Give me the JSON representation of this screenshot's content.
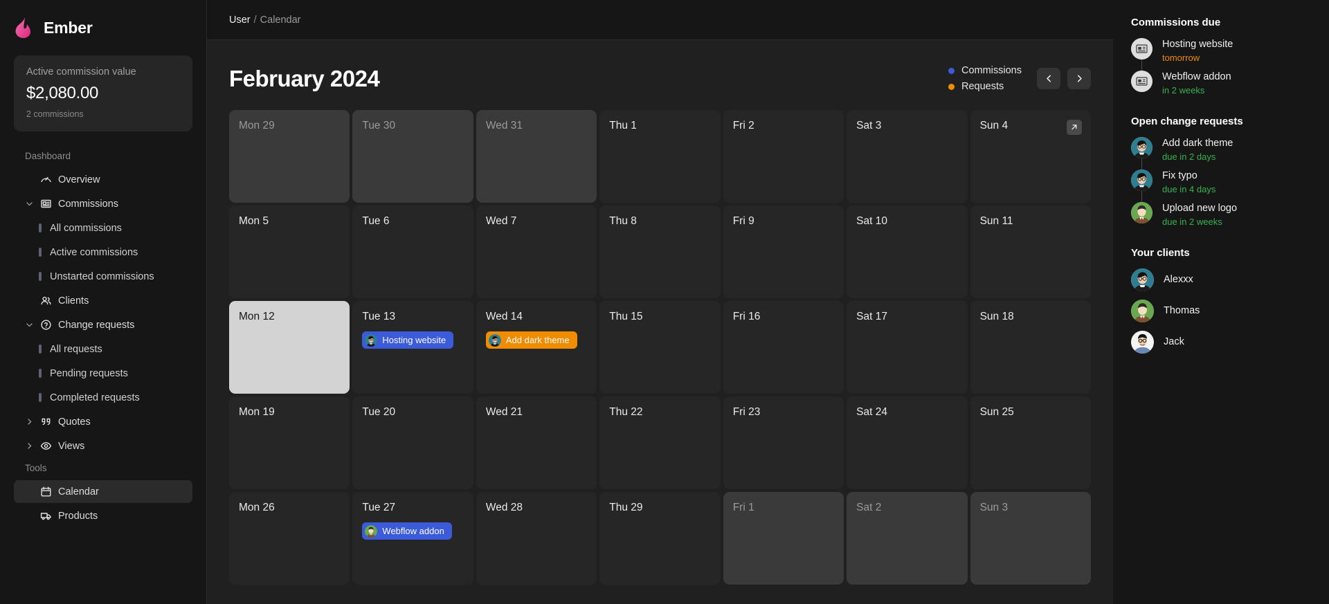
{
  "brand": {
    "name": "Ember",
    "logo_icon": "flame-icon",
    "color": "#ec4899"
  },
  "stat_card": {
    "label": "Active commission value",
    "value": "$2,080.00",
    "sub": "2 commissions"
  },
  "sidebar": {
    "sections": [
      {
        "title": "Dashboard",
        "items": [
          {
            "label": "Overview",
            "icon": "gauge-icon",
            "type": "item",
            "caret": "none",
            "active": false
          },
          {
            "label": "Commissions",
            "icon": "invoice-icon",
            "type": "item",
            "caret": "down",
            "active": false
          },
          {
            "label": "All commissions",
            "type": "child"
          },
          {
            "label": "Active commissions",
            "type": "child"
          },
          {
            "label": "Unstarted commissions",
            "type": "child"
          },
          {
            "label": "Clients",
            "icon": "users-icon",
            "type": "item",
            "caret": "none",
            "active": false
          },
          {
            "label": "Change requests",
            "icon": "help-circle-icon",
            "type": "item",
            "caret": "down",
            "active": false
          },
          {
            "label": "All requests",
            "type": "child"
          },
          {
            "label": "Pending requests",
            "type": "child"
          },
          {
            "label": "Completed requests",
            "type": "child"
          },
          {
            "label": "Quotes",
            "icon": "quote-icon",
            "type": "item",
            "caret": "right",
            "active": false
          },
          {
            "label": "Views",
            "icon": "eye-icon",
            "type": "item",
            "caret": "right",
            "active": false
          }
        ]
      },
      {
        "title": "Tools",
        "items": [
          {
            "label": "Calendar",
            "icon": "calendar-icon",
            "type": "item",
            "caret": "none",
            "active": true
          },
          {
            "label": "Products",
            "icon": "truck-icon",
            "type": "item",
            "caret": "none",
            "active": false
          }
        ]
      }
    ]
  },
  "breadcrumb": {
    "current": "User",
    "separator": "/",
    "next": "Calendar"
  },
  "calendar": {
    "title": "February 2024",
    "legend": [
      {
        "label": "Commissions",
        "color": "#3b5bdb"
      },
      {
        "label": "Requests",
        "color": "#f08c00"
      }
    ],
    "prev_label": "‹",
    "next_label": "›",
    "expand_icon": "arrow-up-right-icon",
    "weeks": [
      [
        {
          "label": "Mon 29",
          "muted": true
        },
        {
          "label": "Tue 30",
          "muted": true
        },
        {
          "label": "Wed 31",
          "muted": true
        },
        {
          "label": "Thu 1"
        },
        {
          "label": "Fri 2"
        },
        {
          "label": "Sat 3"
        },
        {
          "label": "Sun 4",
          "expand": true
        }
      ],
      [
        {
          "label": "Mon 5"
        },
        {
          "label": "Tue 6"
        },
        {
          "label": "Wed 7"
        },
        {
          "label": "Thu 8"
        },
        {
          "label": "Fri 9"
        },
        {
          "label": "Sat 10"
        },
        {
          "label": "Sun 11"
        }
      ],
      [
        {
          "label": "Mon 12",
          "today": true
        },
        {
          "label": "Tue 13",
          "events": [
            {
              "title": "Hosting website",
              "type": "commission",
              "color": "#3b5bdb",
              "avatar": "avatar-alex"
            }
          ]
        },
        {
          "label": "Wed 14",
          "events": [
            {
              "title": "Add dark theme",
              "type": "request",
              "color": "#f08c00",
              "avatar": "avatar-alex"
            }
          ]
        },
        {
          "label": "Thu 15"
        },
        {
          "label": "Fri 16"
        },
        {
          "label": "Sat 17"
        },
        {
          "label": "Sun 18"
        }
      ],
      [
        {
          "label": "Mon 19"
        },
        {
          "label": "Tue 20"
        },
        {
          "label": "Wed 21"
        },
        {
          "label": "Thu 22"
        },
        {
          "label": "Fri 23"
        },
        {
          "label": "Sat 24"
        },
        {
          "label": "Sun 25"
        }
      ],
      [
        {
          "label": "Mon 26"
        },
        {
          "label": "Tue 27",
          "events": [
            {
              "title": "Webflow addon",
              "type": "commission",
              "color": "#3b5bdb",
              "avatar": "avatar-thomas"
            }
          ]
        },
        {
          "label": "Wed 28"
        },
        {
          "label": "Thu 29"
        },
        {
          "label": "Fri 1",
          "muted": true
        },
        {
          "label": "Sat 2",
          "muted": true
        },
        {
          "label": "Sun 3",
          "muted": true
        }
      ]
    ]
  },
  "rail": {
    "commissions_due": {
      "title": "Commissions due",
      "items": [
        {
          "name": "Hosting website",
          "meta": "tomorrow",
          "meta_color": "#f08c00",
          "avatar": "invoice-icon"
        },
        {
          "name": "Webflow addon",
          "meta": "in 2 weeks",
          "meta_color": "#37b24d",
          "avatar": "invoice-icon"
        }
      ]
    },
    "open_change_requests": {
      "title": "Open change requests",
      "items": [
        {
          "name": "Add dark theme",
          "meta": "due in 2 days",
          "meta_color": "#37b24d",
          "avatar": "avatar-alex"
        },
        {
          "name": "Fix typo",
          "meta": "due in 4 days",
          "meta_color": "#37b24d",
          "avatar": "avatar-alex"
        },
        {
          "name": "Upload new logo",
          "meta": "due in 2 weeks",
          "meta_color": "#37b24d",
          "avatar": "avatar-thomas"
        }
      ]
    },
    "your_clients": {
      "title": "Your clients",
      "items": [
        {
          "name": "Alexxx",
          "avatar": "avatar-alex"
        },
        {
          "name": "Thomas",
          "avatar": "avatar-thomas"
        },
        {
          "name": "Jack",
          "avatar": "avatar-jack"
        }
      ]
    }
  }
}
